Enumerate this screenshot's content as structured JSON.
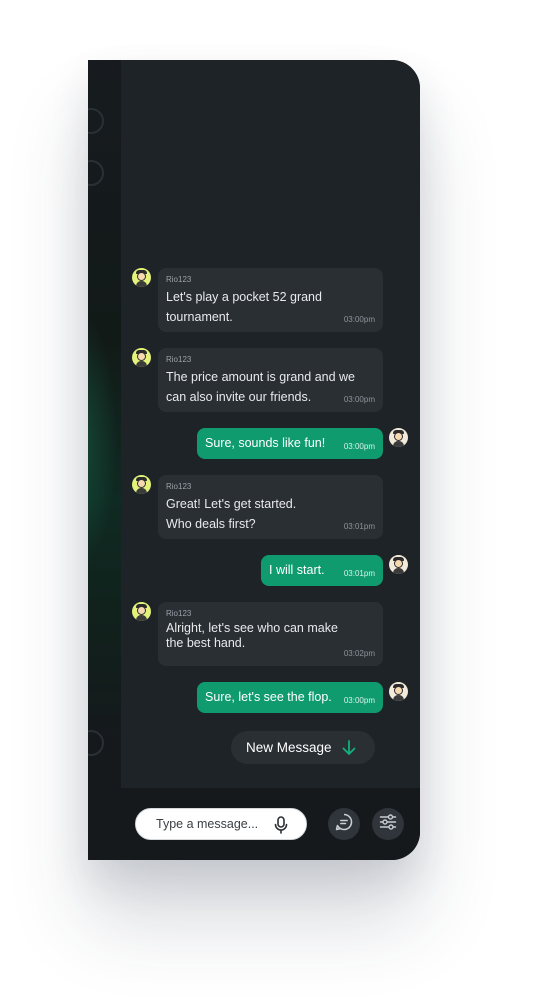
{
  "messages": [
    {
      "direction": "in",
      "sender": "Rio123",
      "text": "Let's play a pocket 52 grand tournament.",
      "time": "03:00pm"
    },
    {
      "direction": "in",
      "sender": "Rio123",
      "text": "The price amount is grand and we can also invite our friends.",
      "time": "03:00pm"
    },
    {
      "direction": "out",
      "text": "Sure, sounds like fun!",
      "time": "03:00pm"
    },
    {
      "direction": "in",
      "sender": "Rio123",
      "text": "Great! Let's get started. Who deals first?",
      "time": "03:01pm"
    },
    {
      "direction": "out",
      "text": "I will start.",
      "time": "03:01pm"
    },
    {
      "direction": "in",
      "sender": "Rio123",
      "text": "Alright, let's see who can make the best hand.",
      "time": "03:02pm"
    },
    {
      "direction": "out",
      "text": "Sure, let's see the flop.",
      "time": "03:00pm"
    }
  ],
  "new_message_button": {
    "label": "New Message",
    "icon": "arrow-down-icon"
  },
  "composer": {
    "placeholder": "Type a message...",
    "mic_icon": "microphone-icon"
  },
  "actions": [
    {
      "icon": "chat-bubble-icon"
    },
    {
      "icon": "sliders-icon"
    }
  ],
  "colors": {
    "accent": "#0f9b6e",
    "chat_background": "#1e2327",
    "incoming_bubble": "#2a2f34",
    "bottom_bar": "#16191c"
  }
}
